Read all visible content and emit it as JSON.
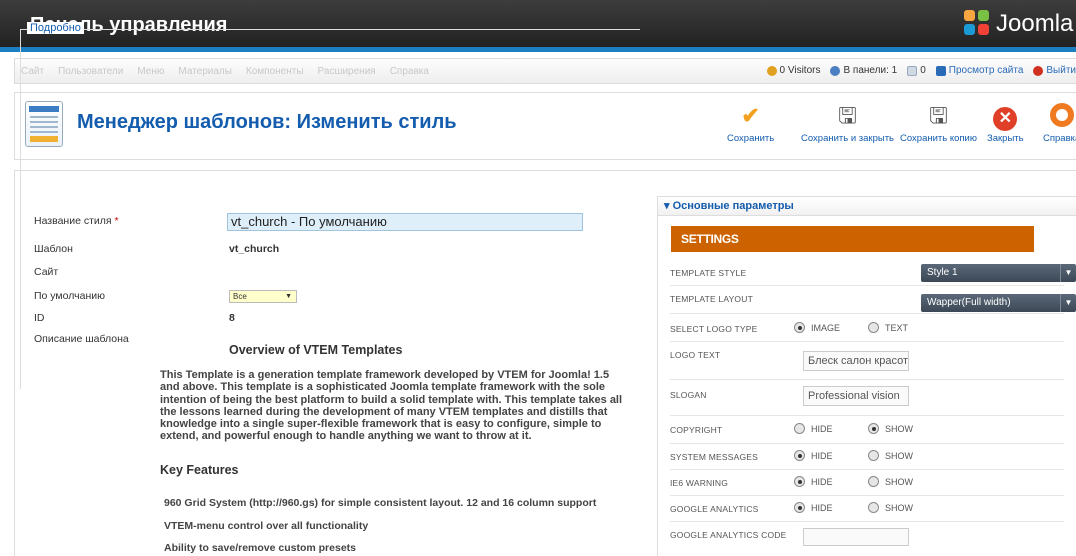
{
  "header": {
    "title": "Панель управления",
    "logo_text": "Joomla"
  },
  "menu": {
    "items": [
      "Сайт",
      "Пользователи",
      "Меню",
      "Материалы",
      "Компоненты",
      "Расширения",
      "Справка"
    ]
  },
  "status": {
    "visitors": "0 Visitors",
    "admins": "В панели: 1",
    "messages": "0",
    "preview": "Просмотр сайта",
    "logout": "Выйти"
  },
  "toolbar": {
    "title": "Менеджер шаблонов: Изменить стиль",
    "save": "Сохранить",
    "save_close": "Сохранить и закрыть",
    "save_copy": "Сохранить копию",
    "close": "Закрыть",
    "help": "Справка"
  },
  "details": {
    "legend": "Подробно",
    "style_name_label": "Название стиля",
    "required_mark": "*",
    "style_name_value": "vt_church - По умолчанию",
    "template_label": "Шаблон",
    "template_value": "vt_church",
    "site_label": "Сайт",
    "default_label": "По умолчанию",
    "default_value": "Все",
    "id_label": "ID",
    "id_value": "8",
    "description_label": "Описание шаблона",
    "overview_heading": "Overview of VTEM Templates",
    "overview_text": "This Template is a generation template framework developed by VTEM for Joomla! 1.5 and above. This template is a sophisticated Joomla template framework with the sole intention of being the best platform to build a solid template with. This template takes all the lessons learned during the development of many VTEM templates and distills that knowledge into a single super-flexible framework that is easy to configure, simple to extend, and powerful enough to handle anything we want to throw at it.",
    "key_features_heading": "Key Features",
    "features": [
      "960 Grid System (http://960.gs) for simple consistent layout. 12 and 16 column support",
      "VTEM-menu control over all functionality",
      "Ability to save/remove custom presets"
    ]
  },
  "params": {
    "panel_title": "Основные параметры",
    "settings_heading": "SETTINGS",
    "template_style_label": "TEMPLATE STYLE",
    "template_style_value": "Style 1",
    "template_layout_label": "TEMPLATE LAYOUT",
    "template_layout_value": "Wapper(Full width)",
    "logo_type_label": "SELECT LOGO TYPE",
    "logo_type_image": "IMAGE",
    "logo_type_text": "TEXT",
    "logo_text_label": "LOGO TEXT",
    "logo_text_value": "Блеск салон красоты",
    "slogan_label": "SLOGAN",
    "slogan_value": "Professional vision",
    "copyright_label": "COPYRIGHT",
    "system_messages_label": "SYSTEM MESSAGES",
    "ie6_label": "IE6 WARNING",
    "ga_label": "GOOGLE ANALYTICS",
    "ga_code_label": "GOOGLE ANALYTICS CODE",
    "hide": "HIDE",
    "show": "SHOW"
  },
  "colors": {
    "accent": "#135cae",
    "settings_bar": "#cc6300",
    "header_blue": "#1b7fc1"
  }
}
